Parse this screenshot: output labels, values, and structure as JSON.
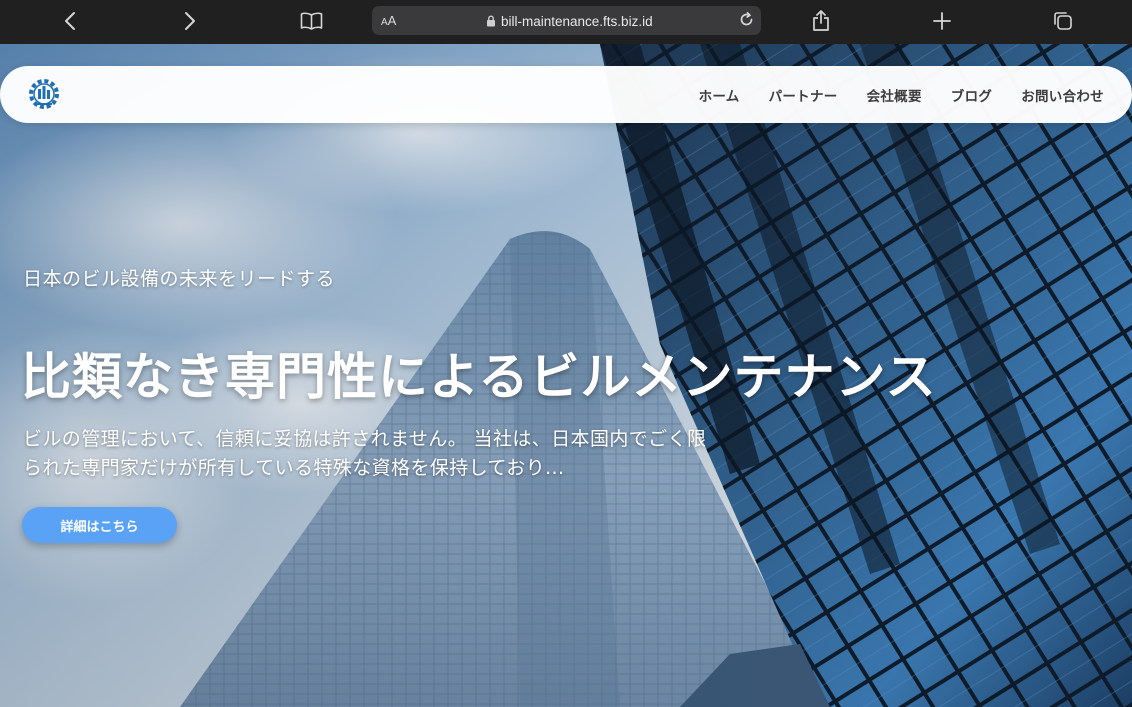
{
  "browser": {
    "address_prefix_small": "A",
    "address_prefix_big": "A",
    "url": "bill-maintenance.fts.biz.id",
    "icons": [
      "back-icon",
      "forward-icon",
      "bookmarks-icon",
      "lock-icon",
      "reload-icon",
      "share-icon",
      "new-tab-icon",
      "tabs-icon"
    ]
  },
  "nav": {
    "items": [
      {
        "label": "ホーム"
      },
      {
        "label": "パートナー"
      },
      {
        "label": "会社概要"
      },
      {
        "label": "ブログ"
      },
      {
        "label": "お問い合わせ"
      }
    ]
  },
  "hero": {
    "tagline": "日本のビル設備の未来をリードする",
    "headline": "比類なき専門性によるビルメンテナンス",
    "description": "ビルの管理において、信頼に妥協は許されません。 当社は、日本国内でごく限られた専門家だけが所有している特殊な資格を保持しており...",
    "cta_label": "詳細はこちら"
  },
  "colors": {
    "accent": "#5aa2f5",
    "browser_bar": "#202020",
    "nav_text": "#3d3d3d",
    "logo_blue": "#1f6fb5"
  }
}
